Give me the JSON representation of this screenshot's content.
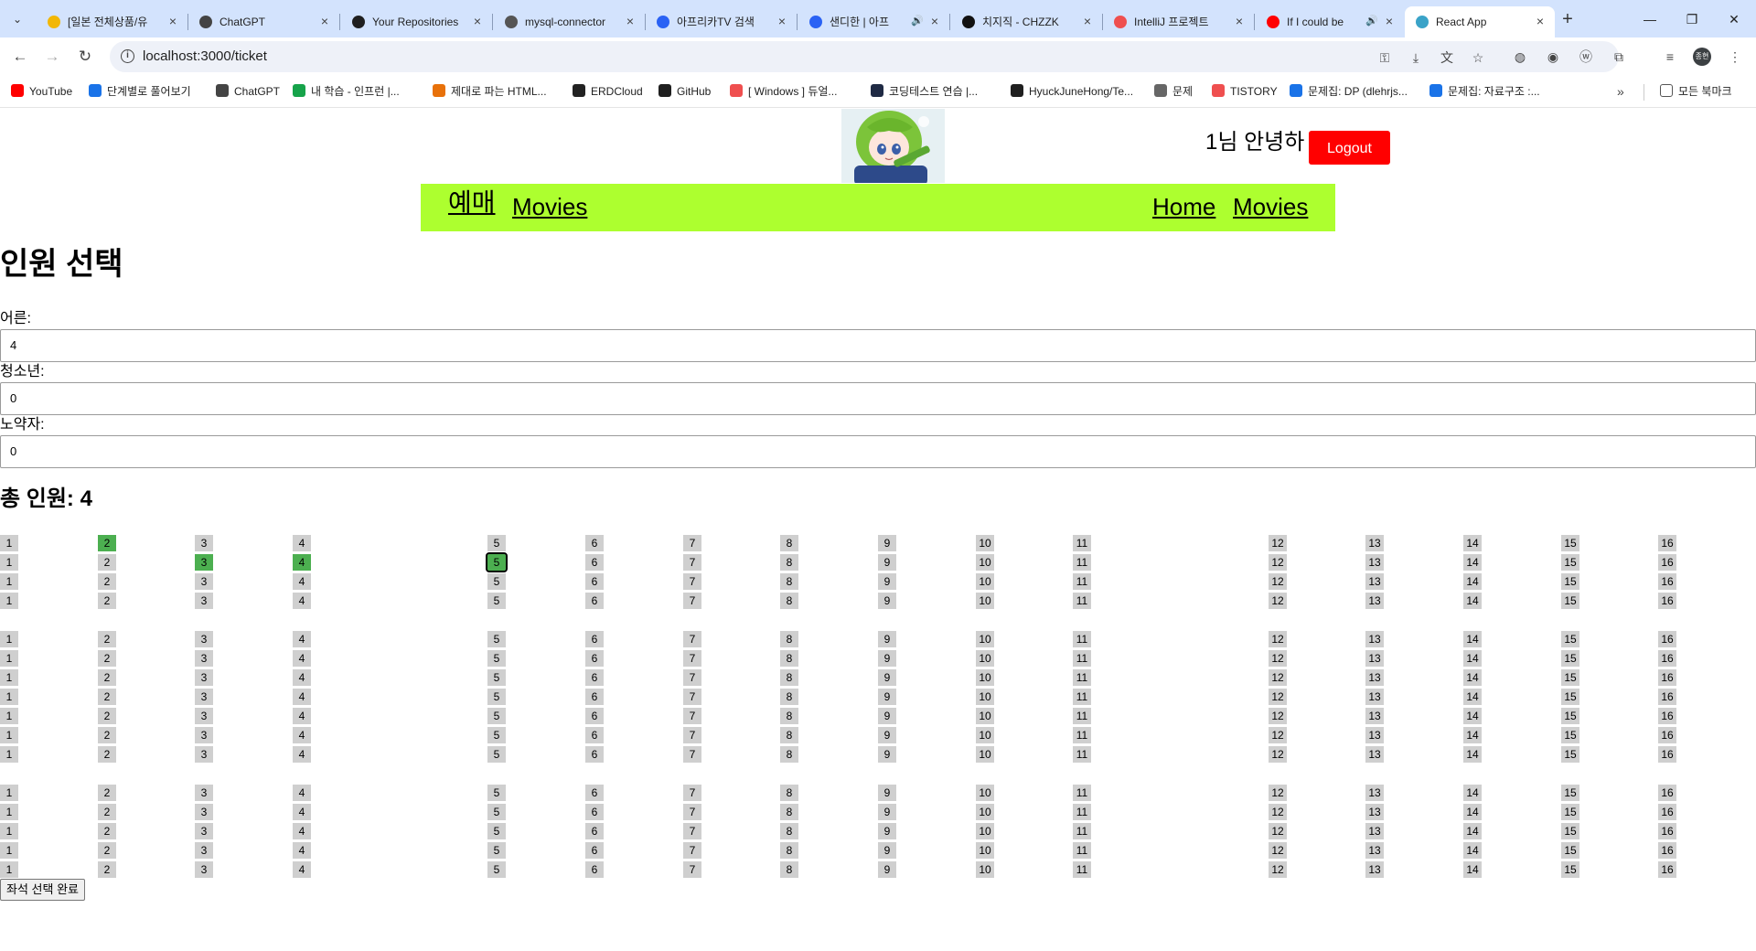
{
  "browser": {
    "tabs": [
      {
        "title": "[일본 전체상품/유",
        "color": "#f2b705",
        "icon": "pin-icon",
        "active": false
      },
      {
        "title": "ChatGPT",
        "color": "#444444",
        "icon": "chatgpt-icon",
        "active": false
      },
      {
        "title": "Your Repositories",
        "color": "#1f1f1f",
        "icon": "github-icon",
        "active": false
      },
      {
        "title": "mysql-connector",
        "color": "#555555",
        "icon": "avatar-icon",
        "active": false
      },
      {
        "title": "아프리카TV 검색",
        "color": "#2a62f4",
        "icon": "afreeca-icon",
        "active": false
      },
      {
        "title": "샌디한 | 아프",
        "color": "#2a62f4",
        "icon": "afreeca-icon",
        "active": false,
        "sound": true
      },
      {
        "title": "치지직 - CHZZK",
        "color": "#111111",
        "icon": "chzzk-icon",
        "active": false
      },
      {
        "title": "IntelliJ 프로젝트",
        "color": "#ef4f4f",
        "icon": "tistory-icon",
        "active": false
      },
      {
        "title": "If I could be",
        "color": "#ff0000",
        "icon": "youtube-icon",
        "active": false,
        "sound": true
      },
      {
        "title": "React App",
        "color": "#3aa3c8",
        "icon": "react-icon",
        "active": true
      }
    ],
    "url": "localhost:3000/ticket",
    "profile_label": "종현",
    "bookmarks": [
      {
        "label": "YouTube",
        "color": "#ff0000"
      },
      {
        "label": "단계별로 풀어보기",
        "color": "#1a73e8"
      },
      {
        "label": "ChatGPT",
        "color": "#444444"
      },
      {
        "label": "내 학습 - 인프런 |...",
        "color": "#16a34a"
      },
      {
        "label": "제대로 파는 HTML...",
        "color": "#e8710a"
      },
      {
        "label": "ERDCloud",
        "color": "#222222"
      },
      {
        "label": "GitHub",
        "color": "#1f1f1f"
      },
      {
        "label": "[ Windows ] 듀얼...",
        "color": "#ef4f4f"
      },
      {
        "label": "코딩테스트 연습 |...",
        "color": "#1f2a44"
      },
      {
        "label": "HyuckJuneHong/Te...",
        "color": "#1f1f1f"
      },
      {
        "label": "문제",
        "color": "#666666"
      },
      {
        "label": "TISTORY",
        "color": "#ef4f4f"
      },
      {
        "label": "문제집: DP (dlehrjs...",
        "color": "#1a73e8"
      },
      {
        "label": "문제집: 자료구조 :...",
        "color": "#1a73e8"
      }
    ],
    "all_bookmarks": "모든 북마크"
  },
  "header": {
    "greeting": "1님 안녕하",
    "logout": "Logout",
    "nav_left": [
      "예매",
      "Movies"
    ],
    "nav_right": [
      "Home",
      "Movies"
    ],
    "nav_color": "#adff2f",
    "logout_color": "#ff0000"
  },
  "form": {
    "title": "인원 선택",
    "fields": [
      {
        "label": "어른:",
        "value": "4"
      },
      {
        "label": "청소년:",
        "value": "0"
      },
      {
        "label": "노약자:",
        "value": "0"
      }
    ],
    "total_label": "총 인원: 4",
    "seat_colors": {
      "available": "#cfcfcf",
      "selected": "#4caf50"
    },
    "seat_numbers": [
      "1",
      "2",
      "3",
      "4",
      "5",
      "6",
      "7",
      "8",
      "9",
      "10",
      "11",
      "12",
      "13",
      "14",
      "15",
      "16"
    ],
    "row_count": 16,
    "selected_seats": [
      [
        0,
        1
      ],
      [
        1,
        2
      ],
      [
        1,
        3
      ],
      [
        1,
        4
      ]
    ],
    "focused_seat": [
      1,
      4
    ],
    "submit": "좌석 선택 완료"
  }
}
